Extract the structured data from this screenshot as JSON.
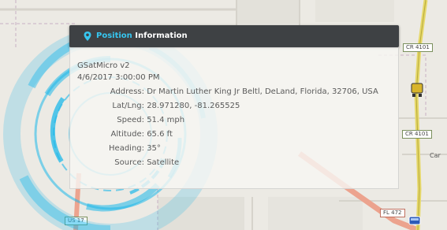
{
  "map": {
    "shields": [
      {
        "text": "CR 4101"
      },
      {
        "text": "CR 4101"
      },
      {
        "text": "FL 472"
      },
      {
        "text": "US 17"
      }
    ],
    "labels": [
      {
        "text": "Car"
      }
    ]
  },
  "popup": {
    "title_accent": "Position ",
    "title_rest": "Information",
    "pin_icon": "location-pin-icon",
    "device": "GSatMicro v2",
    "datetime": "4/6/2017 3:00:00 PM",
    "rows": [
      {
        "label": "Address:",
        "value": "Dr Martin Luther King Jr Beltl, DeLand, Florida, 32706, USA"
      },
      {
        "label": "Lat/Lng:",
        "value": "28.971280, -81.265525"
      },
      {
        "label": "Speed:",
        "value": "51.4 mph"
      },
      {
        "label": "Altitude:",
        "value": "65.6 ft"
      },
      {
        "label": "Heading:",
        "value": "35°"
      },
      {
        "label": "Source:",
        "value": "Satellite"
      }
    ]
  },
  "colors": {
    "accent": "#36c6f0",
    "header_bg": "#3e4144",
    "radar": "#1fb8ea"
  }
}
